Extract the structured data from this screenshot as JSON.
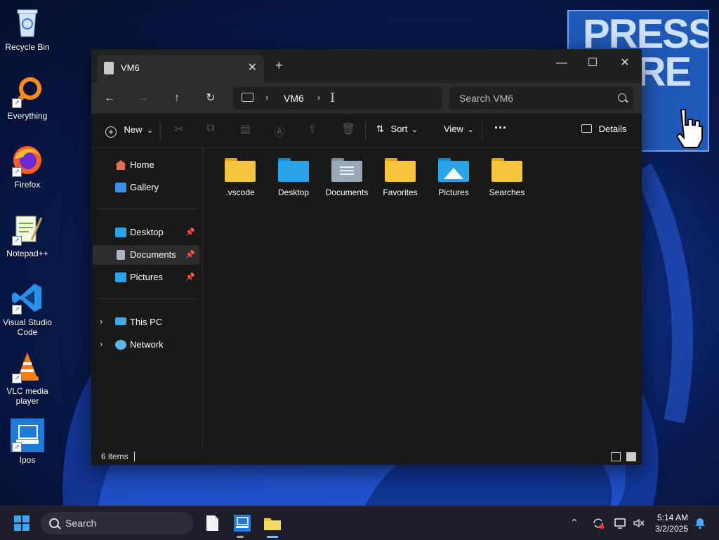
{
  "desktop": {
    "icons": [
      {
        "name": "recycle-bin",
        "label": "Recycle Bin"
      },
      {
        "name": "everything",
        "label": "Everything"
      },
      {
        "name": "firefox",
        "label": "Firefox"
      },
      {
        "name": "notepadpp",
        "label": "Notepad++"
      },
      {
        "name": "vscode",
        "label": "Visual Studio Code"
      },
      {
        "name": "vlc",
        "label": "VLC media player"
      },
      {
        "name": "ipos",
        "label": "Ipos"
      }
    ],
    "promo_text": "PRESS HERE"
  },
  "explorer": {
    "tab_title": "VM6",
    "close_tab_glyph": "✕",
    "new_tab_glyph": "+",
    "window_controls": {
      "minimize": "—",
      "maximize": "☐",
      "close": "✕"
    },
    "nav": {
      "back": "←",
      "forward": "→",
      "up": "↑",
      "refresh": "↻"
    },
    "address": {
      "crumb": "VM6",
      "chevron": "›",
      "caret": "I"
    },
    "search_placeholder": "Search VM6",
    "toolbar": {
      "new_label": "New",
      "sort_label": "Sort",
      "view_label": "View",
      "more_label": "···",
      "details_label": "Details",
      "dropdown_glyph": "⌄"
    },
    "sidebar": {
      "home": "Home",
      "gallery": "Gallery",
      "pinned": [
        {
          "label": "Desktop",
          "pin": "📌"
        },
        {
          "label": "Documents",
          "pin": "📌"
        },
        {
          "label": "Pictures",
          "pin": "📌"
        }
      ],
      "this_pc": "This PC",
      "network": "Network",
      "expand_glyph": "›"
    },
    "folders": [
      {
        "label": ".vscode",
        "color": "#f3c43c"
      },
      {
        "label": "Desktop",
        "color": "#29a4e8"
      },
      {
        "label": "Documents",
        "color": "#9aa8b8"
      },
      {
        "label": "Favorites",
        "color": "#f3c43c"
      },
      {
        "label": "Pictures",
        "color": "#29a4e8"
      },
      {
        "label": "Searches",
        "color": "#f3c43c"
      }
    ],
    "status": "6 items"
  },
  "taskbar": {
    "search_placeholder": "Search",
    "time": "5:14 AM",
    "date": "3/2/2025",
    "tray": {
      "chevron": "⌃"
    }
  },
  "colors": {
    "accent": "#3ea5f4",
    "folder_yellow": "#f3c43c"
  }
}
